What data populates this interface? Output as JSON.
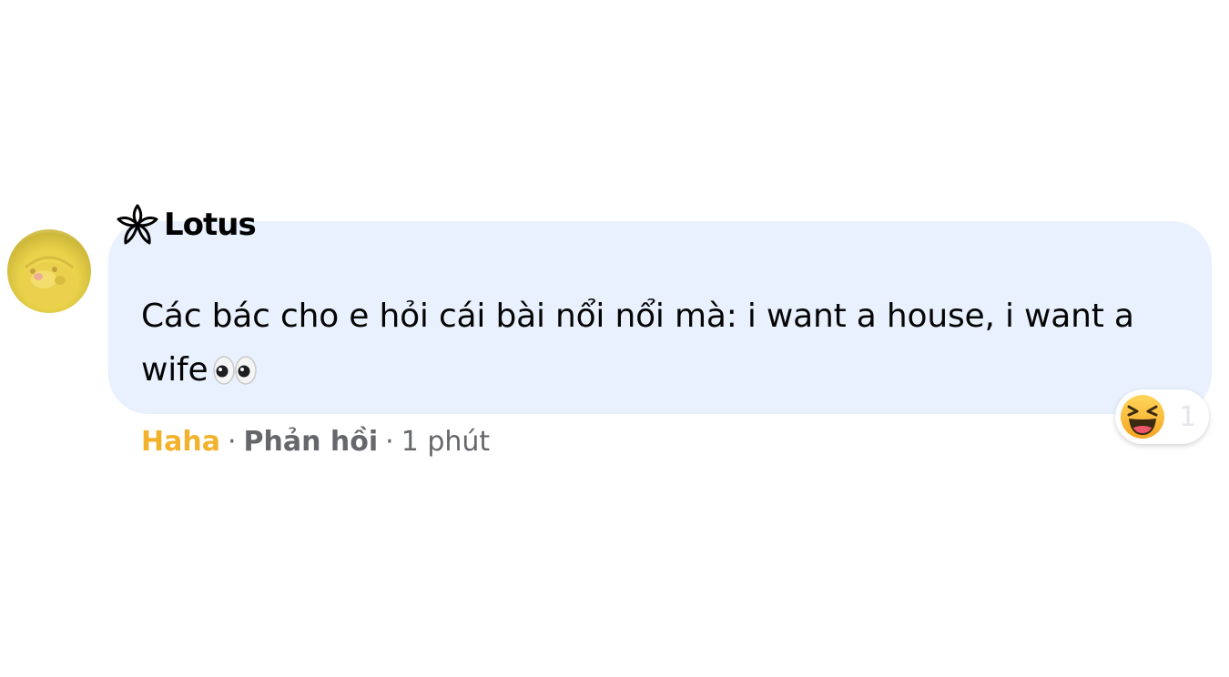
{
  "comment": {
    "author": "Lotus",
    "author_logo_icon": "lotus-flower-icon",
    "avatar_icon": "yellow-cartoon-avatar",
    "text": "Các bác cho e hỏi cái bài nổi nổi mà: i want a house, i want a wife",
    "text_emoji": "eyes-emoji",
    "bubble_color": "#e8f1fd"
  },
  "actions": {
    "reaction_label": "Haha",
    "separator": "·",
    "reply_label": "Phản hồi",
    "timestamp": "1 phút",
    "reaction_color": "#f2b22c"
  },
  "reactions": {
    "icon": "haha-emoji",
    "count": "1"
  }
}
